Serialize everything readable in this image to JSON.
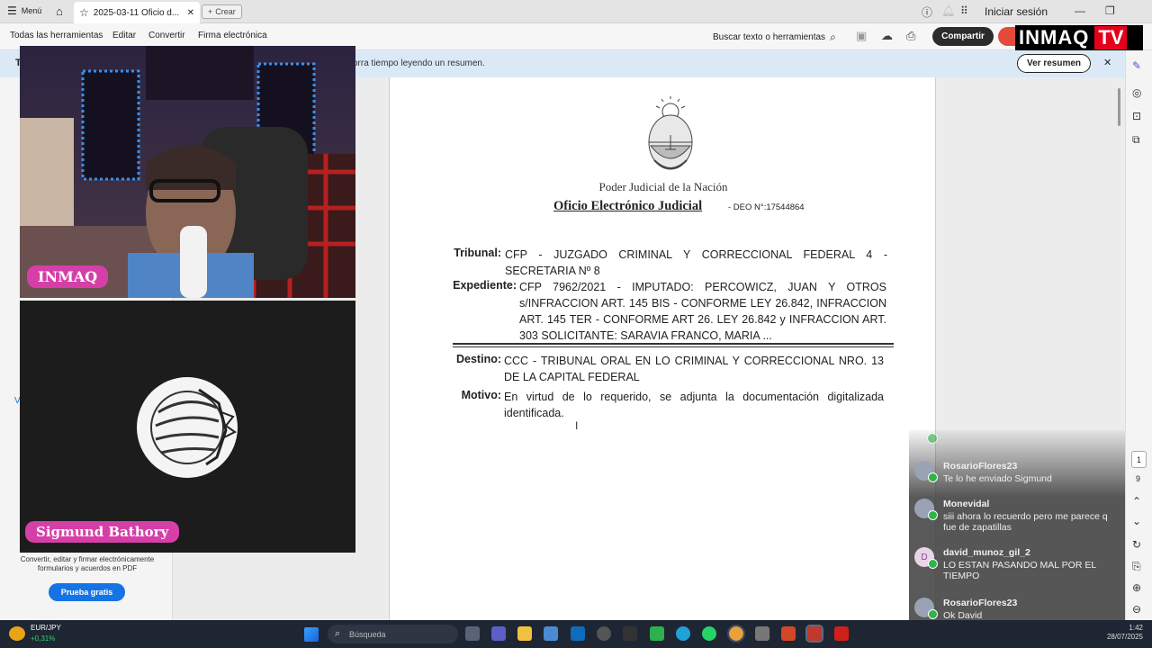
{
  "tabbar": {
    "menu": "Menú",
    "tab_title": "2025-03-11 Oficio d...",
    "new_tab": "Crear",
    "signin": "Iniciar sesión"
  },
  "toolbar": {
    "all_tools": "Todas las herramientas",
    "edit": "Editar",
    "convert": "Convertir",
    "esign": "Firma electrónica",
    "search": "Buscar texto o herramientas",
    "share": "Compartir"
  },
  "banner": {
    "left_text": "T",
    "text": "orra tiempo leyendo un resumen.",
    "button": "Ver resumen"
  },
  "left_panel": {
    "v_letter": "V",
    "promo": "Convertir, editar y firmar electrónicamente formularios y acuerdos en PDF",
    "trial_button": "Prueba gratis"
  },
  "document": {
    "org": "Poder Judicial de la Nación",
    "title": "Oficio Electrónico Judicial",
    "deo": "- DEO N°:17544864",
    "tribunal_label": "Tribunal:",
    "tribunal_value": "CFP - JUZGADO CRIMINAL Y CORRECCIONAL FEDERAL 4 - SECRETARIA Nº 8",
    "expediente_label": "Expediente:",
    "expediente_value": "CFP 7962/2021 - IMPUTADO: PERCOWICZ, JUAN Y OTROS s/INFRACCION ART. 145 BIS - CONFORME LEY 26.842, INFRACCION ART. 145 TER - CONFORME ART 26. LEY 26.842 y INFRACCION ART. 303 SOLICITANTE: SARAVIA FRANCO, MARIA ...",
    "destino_label": "Destino:",
    "destino_value": "CCC - TRIBUNAL ORAL EN LO CRIMINAL Y CORRECCIONAL NRO. 13 DE LA CAPITAL FEDERAL",
    "motivo_label": "Motivo:",
    "motivo_value": "En virtud de lo requerido, se adjunta la documentación digitalizada identificada."
  },
  "stream": {
    "cam1_tag": "INMAQ",
    "cam2_tag": "Sigmund Bathory",
    "logo_a": "INMAQ",
    "logo_b": "TV"
  },
  "chat": [
    {
      "user": "RosarioFlores23",
      "text": "Te lo he enviado Sigmund"
    },
    {
      "user": "Monevidal",
      "text": "siii ahora lo recuerdo pero me parece q fue de zapatillas"
    },
    {
      "user": "david_munoz_gil_2",
      "text": "LO ESTAN PASANDO MAL POR EL TIEMPO",
      "avatar": "D"
    },
    {
      "user": "RosarioFlores23",
      "text": "Ok David"
    }
  ],
  "rail": {
    "page": "1",
    "page_total": "9"
  },
  "taskbar": {
    "fx_pair": "EUR/JPY",
    "fx_change": "+0,31%",
    "search": "Búsqueda",
    "time": "1:42",
    "date": "28/07/2025"
  }
}
